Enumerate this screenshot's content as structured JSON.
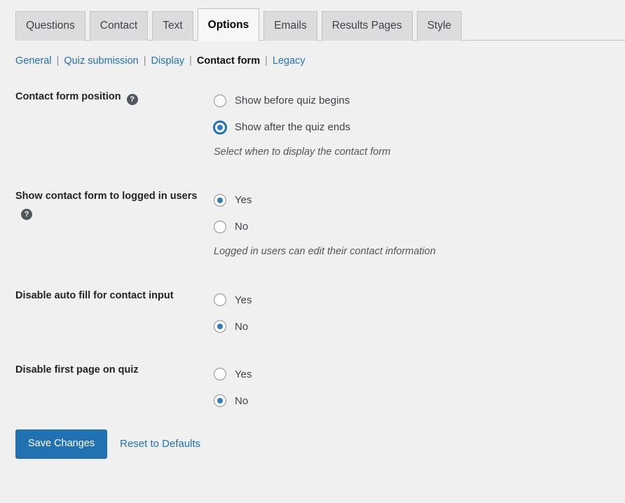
{
  "tabs": [
    {
      "label": "Questions",
      "active": false
    },
    {
      "label": "Contact",
      "active": false
    },
    {
      "label": "Text",
      "active": false
    },
    {
      "label": "Options",
      "active": true
    },
    {
      "label": "Emails",
      "active": false
    },
    {
      "label": "Results Pages",
      "active": false
    },
    {
      "label": "Style",
      "active": false
    }
  ],
  "subnav": {
    "items": [
      {
        "label": "General",
        "current": false
      },
      {
        "label": "Quiz submission",
        "current": false
      },
      {
        "label": "Display",
        "current": false
      },
      {
        "label": "Contact form",
        "current": true
      },
      {
        "label": "Legacy",
        "current": false
      }
    ],
    "separator": "|"
  },
  "settings": [
    {
      "label": "Contact form position",
      "has_help": true,
      "help_glyph": "?",
      "options": [
        {
          "label": "Show before quiz begins",
          "checked": false,
          "focused": false
        },
        {
          "label": "Show after the quiz ends",
          "checked": true,
          "focused": true
        }
      ],
      "description": "Select when to display the contact form"
    },
    {
      "label": "Show contact form to logged in users",
      "has_help": true,
      "help_glyph": "?",
      "options": [
        {
          "label": "Yes",
          "checked": true,
          "focused": false
        },
        {
          "label": "No",
          "checked": false,
          "focused": false
        }
      ],
      "description": "Logged in users can edit their contact information"
    },
    {
      "label": "Disable auto fill for contact input",
      "has_help": false,
      "help_glyph": "",
      "options": [
        {
          "label": "Yes",
          "checked": false,
          "focused": false
        },
        {
          "label": "No",
          "checked": true,
          "focused": false
        }
      ],
      "description": ""
    },
    {
      "label": "Disable first page on quiz",
      "has_help": false,
      "help_glyph": "",
      "options": [
        {
          "label": "Yes",
          "checked": false,
          "focused": false
        },
        {
          "label": "No",
          "checked": true,
          "focused": false
        }
      ],
      "description": ""
    }
  ],
  "footer": {
    "save_label": "Save Changes",
    "reset_label": "Reset to Defaults"
  },
  "colors": {
    "accent": "#2271b1",
    "radio_dot": "#2f7cbd",
    "page_bg": "#f0f0f0",
    "tab_bg": "#dcdcde",
    "active_tab_bg": "#f6f7f7"
  }
}
